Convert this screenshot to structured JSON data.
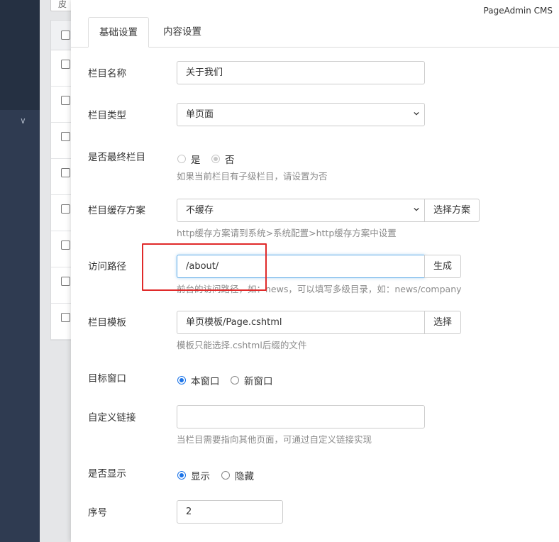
{
  "brand": "PageAdmin CMS",
  "background": {
    "select_stub": "皮"
  },
  "tabs": [
    {
      "label": "基础设置",
      "active": true
    },
    {
      "label": "内容设置",
      "active": false
    }
  ],
  "form": {
    "name": {
      "label": "栏目名称",
      "value": "关于我们"
    },
    "type": {
      "label": "栏目类型",
      "value": "单页面"
    },
    "final": {
      "label": "是否最终栏目",
      "opt_yes": "是",
      "opt_no": "否",
      "selected": "否",
      "help": "如果当前栏目有子级栏目，请设置为否"
    },
    "cache": {
      "label": "栏目缓存方案",
      "value": "不缓存",
      "button": "选择方案",
      "help": "http缓存方案请到系统>系统配置>http缓存方案中设置"
    },
    "path": {
      "label": "访问路径",
      "value": "/about/",
      "button": "生成",
      "help": "前台的访问路径，如：news，可以填写多级目录，如：news/company"
    },
    "template": {
      "label": "栏目模板",
      "value": "单页模板/Page.cshtml",
      "button": "选择",
      "help": "模板只能选择.cshtml后缀的文件"
    },
    "target": {
      "label": "目标窗口",
      "opt_self": "本窗口",
      "opt_new": "新窗口",
      "selected": "本窗口"
    },
    "link": {
      "label": "自定义链接",
      "value": "",
      "help": "当栏目需要指向其他页面，可通过自定义链接实现"
    },
    "display": {
      "label": "是否显示",
      "opt_show": "显示",
      "opt_hide": "隐藏",
      "selected": "显示"
    },
    "order": {
      "label": "序号",
      "value": "2"
    }
  },
  "colors": {
    "accent": "#1a73e8",
    "highlight": "#e02a2a",
    "sidebar": "#2f3b51"
  }
}
